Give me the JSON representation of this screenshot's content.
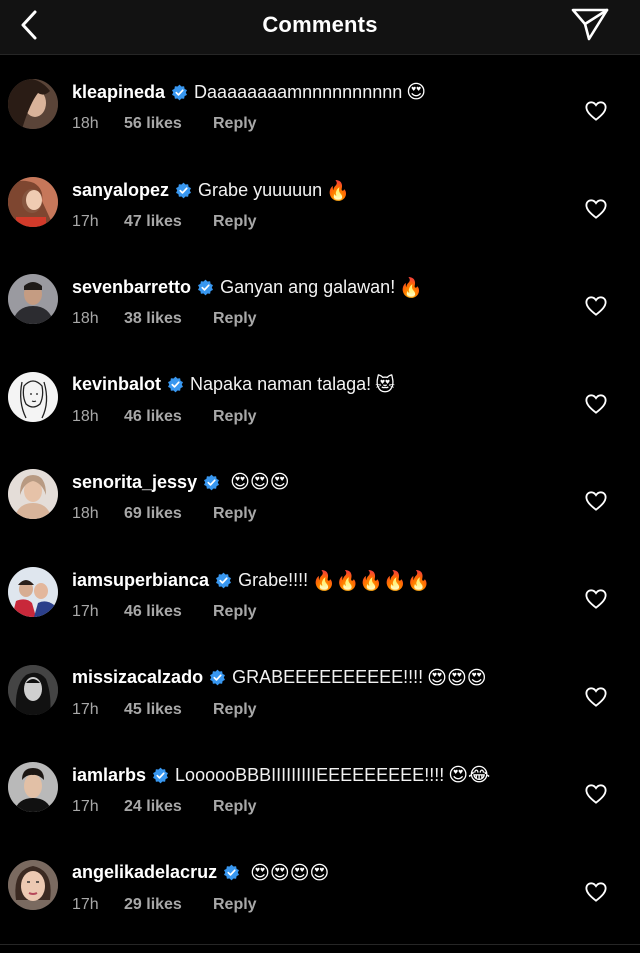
{
  "header": {
    "title": "Comments"
  },
  "comments": [
    {
      "username": "kleapineda",
      "text": "Daaaaaaaamnnnnnnnnnn",
      "emojis": "😍",
      "time": "18h",
      "likes": "56 likes",
      "reply": "Reply"
    },
    {
      "username": "sanyalopez",
      "text": "Grabe yuuuuun",
      "emojis": "🔥",
      "time": "17h",
      "likes": "47 likes",
      "reply": "Reply"
    },
    {
      "username": "sevenbarretto",
      "text": "Ganyan ang galawan!",
      "emojis": "🔥",
      "time": "18h",
      "likes": "38 likes",
      "reply": "Reply"
    },
    {
      "username": "kevinbalot",
      "text": "Napaka naman talaga!",
      "emojis": "😻",
      "time": "18h",
      "likes": "46 likes",
      "reply": "Reply"
    },
    {
      "username": "senorita_jessy",
      "text": "",
      "emojis": "😍😍😍",
      "time": "18h",
      "likes": "69 likes",
      "reply": "Reply"
    },
    {
      "username": "iamsuperbianca",
      "text": "Grabe!!!!",
      "emojis": "🔥🔥🔥🔥🔥",
      "time": "17h",
      "likes": "46 likes",
      "reply": "Reply"
    },
    {
      "username": "missizacalzado",
      "text": "GRABEEEEEEEEEE!!!!",
      "emojis": "😍😍😍",
      "time": "17h",
      "likes": "45 likes",
      "reply": "Reply"
    },
    {
      "username": "iamlarbs",
      "text": "LoooooBBBIIIIIIIIIEEEEEEEEE!!!!",
      "emojis": "😍😂",
      "time": "17h",
      "likes": "24 likes",
      "reply": "Reply"
    },
    {
      "username": "angelikadelacruz",
      "text": "",
      "emojis": "😍😍😍😍",
      "time": "17h",
      "likes": "29 likes",
      "reply": "Reply"
    }
  ],
  "colors": {
    "background": "#000000",
    "header": "#121212",
    "verified": "#3897f0",
    "meta": "#a8a8a8"
  },
  "icons": {
    "back": "chevron-left-icon",
    "share": "paper-plane-icon",
    "like": "heart-outline-icon",
    "verified": "verified-badge-icon"
  }
}
